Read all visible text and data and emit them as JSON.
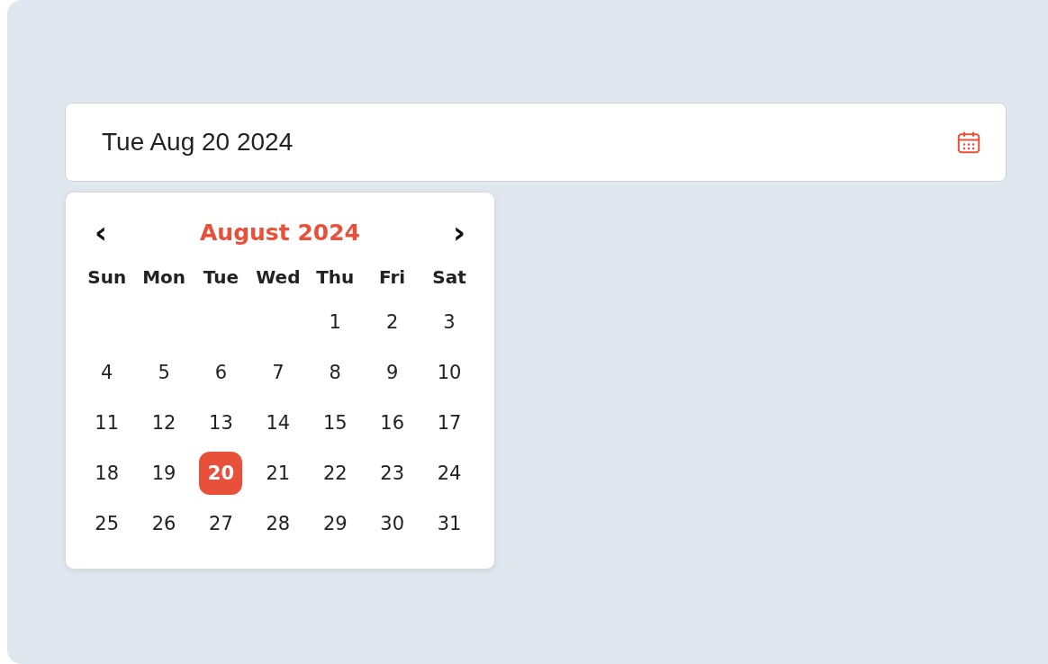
{
  "date_field": {
    "value": "Tue Aug 20 2024"
  },
  "calendar": {
    "month_title": "August 2024",
    "prev_label": "‹",
    "next_label": "›",
    "weekdays": [
      "Sun",
      "Mon",
      "Tue",
      "Wed",
      "Thu",
      "Fri",
      "Sat"
    ],
    "weeks": [
      [
        {
          "day": "1",
          "selected": false
        },
        {
          "day": "2",
          "selected": false
        },
        {
          "day": "3",
          "selected": false
        }
      ],
      [
        {
          "day": "4",
          "selected": false
        },
        {
          "day": "5",
          "selected": false
        },
        {
          "day": "6",
          "selected": false
        },
        {
          "day": "7",
          "selected": false
        },
        {
          "day": "8",
          "selected": false
        },
        {
          "day": "9",
          "selected": false
        },
        {
          "day": "10",
          "selected": false
        }
      ],
      [
        {
          "day": "11",
          "selected": false
        },
        {
          "day": "12",
          "selected": false
        },
        {
          "day": "13",
          "selected": false
        },
        {
          "day": "14",
          "selected": false
        },
        {
          "day": "15",
          "selected": false
        },
        {
          "day": "16",
          "selected": false
        },
        {
          "day": "17",
          "selected": false
        }
      ],
      [
        {
          "day": "18",
          "selected": false
        },
        {
          "day": "19",
          "selected": false
        },
        {
          "day": "20",
          "selected": true
        },
        {
          "day": "21",
          "selected": false
        },
        {
          "day": "22",
          "selected": false
        },
        {
          "day": "23",
          "selected": false
        },
        {
          "day": "24",
          "selected": false
        }
      ],
      [
        {
          "day": "25",
          "selected": false
        },
        {
          "day": "26",
          "selected": false
        },
        {
          "day": "27",
          "selected": false
        },
        {
          "day": "28",
          "selected": false
        },
        {
          "day": "29",
          "selected": false
        },
        {
          "day": "30",
          "selected": false
        },
        {
          "day": "31",
          "selected": false
        }
      ]
    ]
  }
}
